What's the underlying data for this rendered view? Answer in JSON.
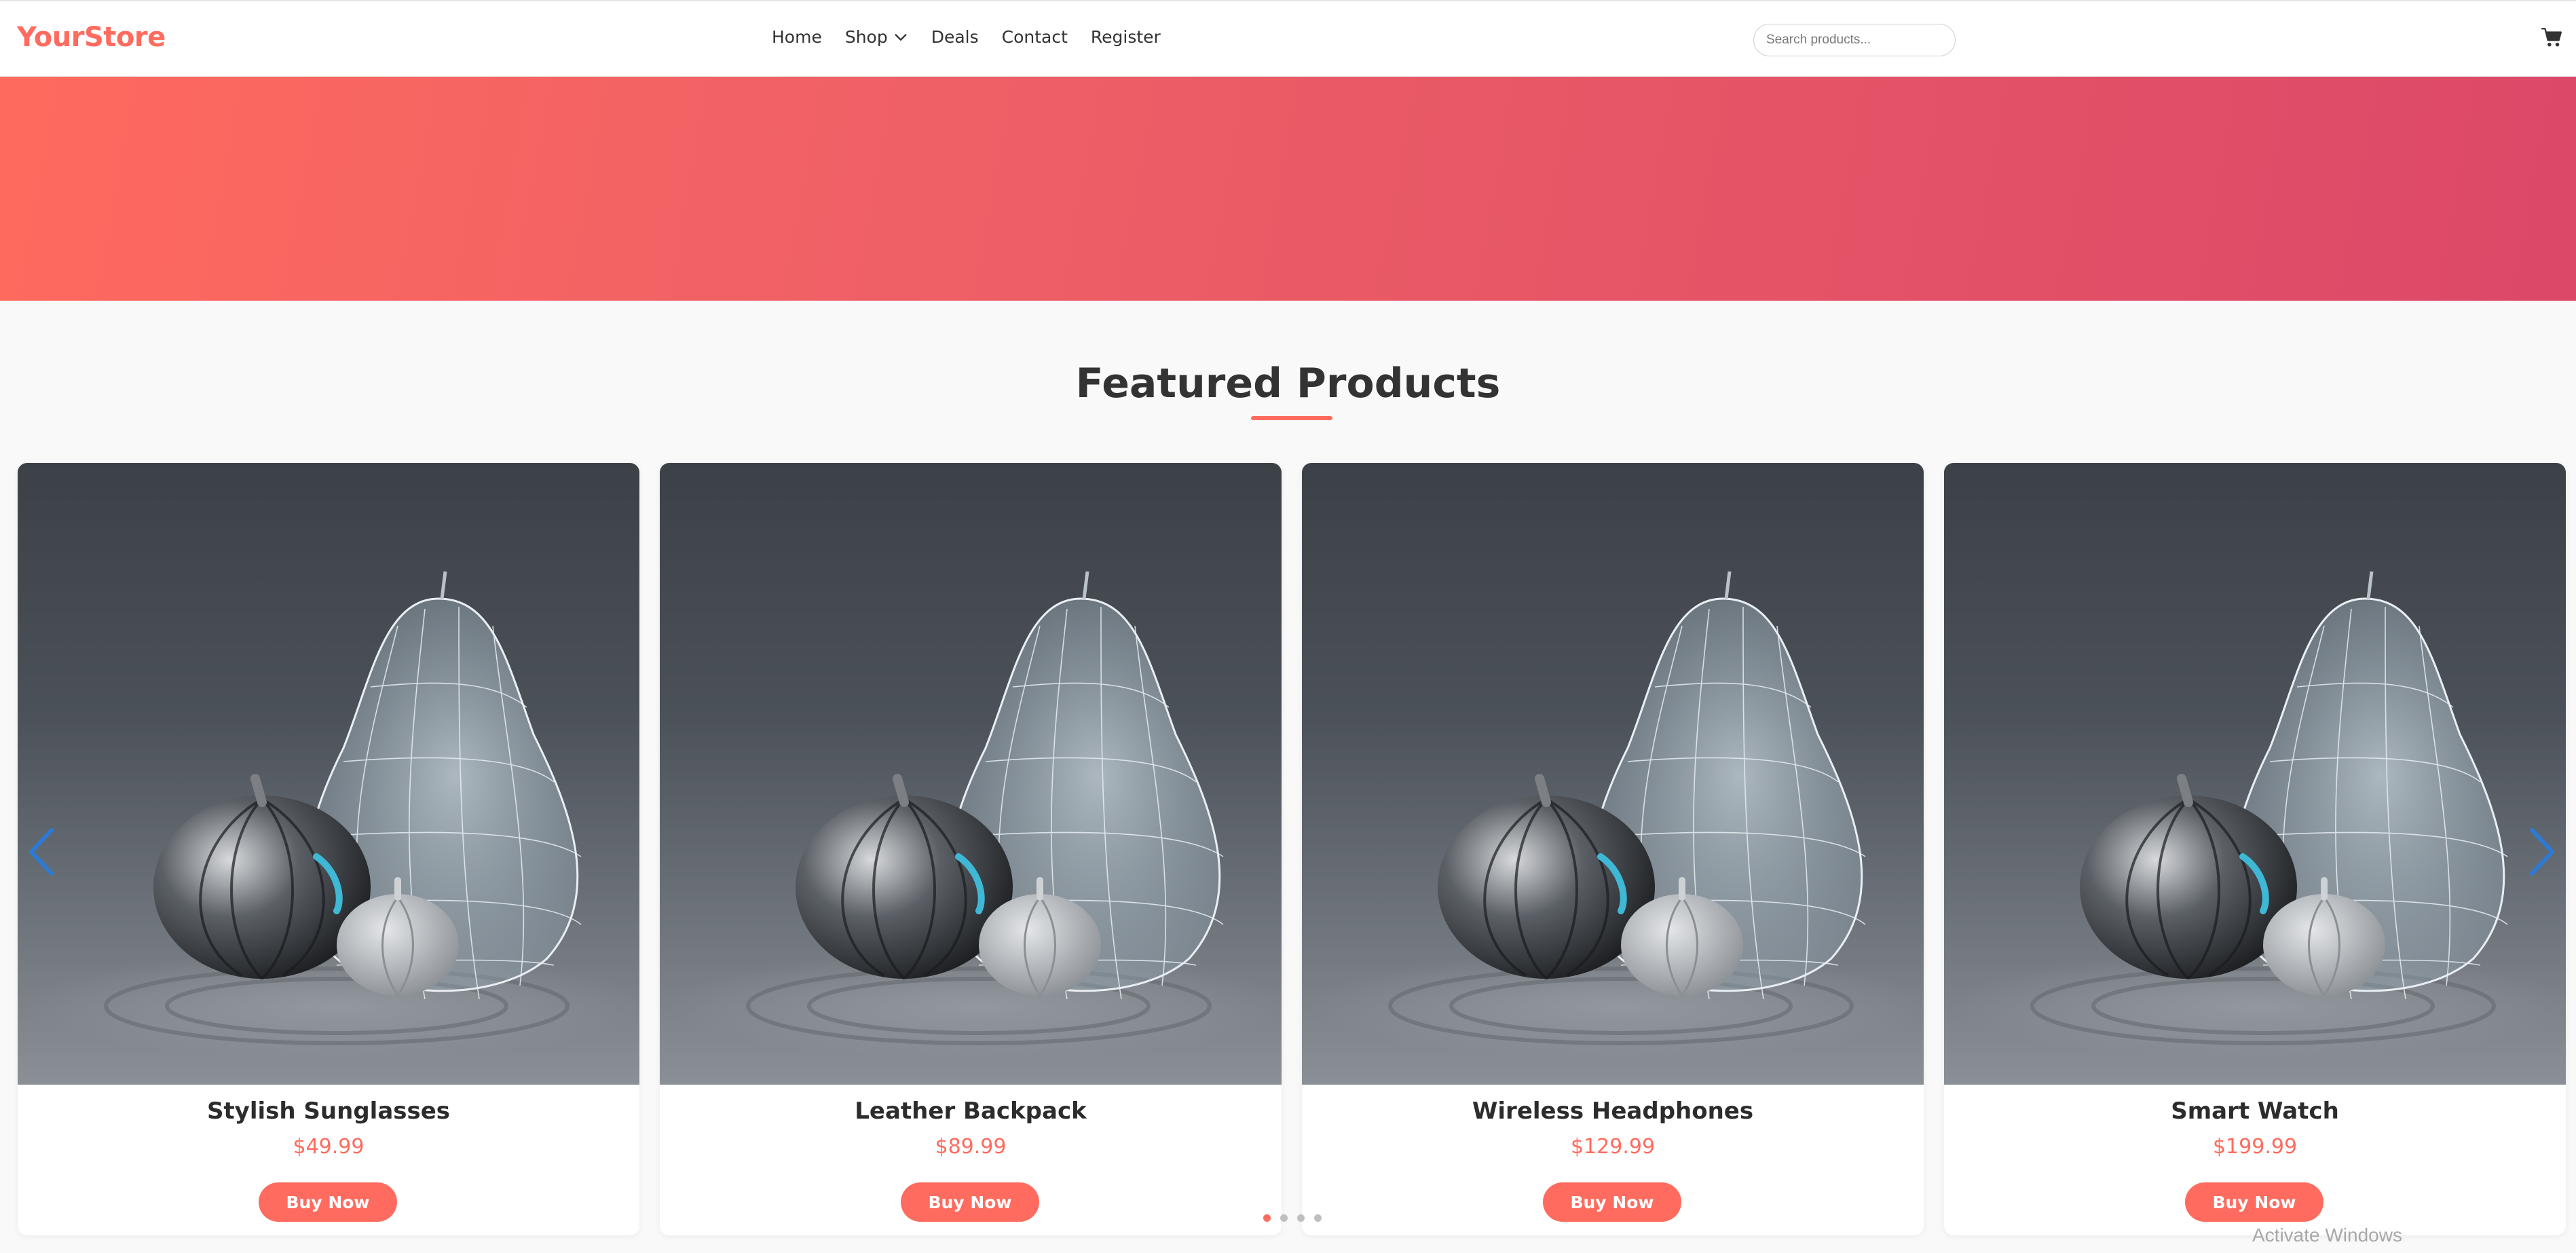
{
  "header": {
    "logo": "YourStore",
    "nav": [
      {
        "label": "Home"
      },
      {
        "label": "Shop"
      },
      {
        "label": "Deals"
      },
      {
        "label": "Contact"
      },
      {
        "label": "Register"
      }
    ],
    "search_placeholder": "Search products...",
    "cart_icon": "shopping-cart-icon"
  },
  "section": {
    "title": "Featured Products"
  },
  "products": [
    {
      "name": "Stylish Sunglasses",
      "price": "$49.99",
      "button": "Buy Now"
    },
    {
      "name": "Leather Backpack",
      "price": "$89.99",
      "button": "Buy Now"
    },
    {
      "name": "Wireless Headphones",
      "price": "$129.99",
      "button": "Buy Now"
    },
    {
      "name": "Smart Watch",
      "price": "$199.99",
      "button": "Buy Now"
    }
  ],
  "carousel": {
    "total_dots": 4,
    "active_dot": 1,
    "prev_icon": "chevron-left-icon",
    "next_icon": "chevron-right-icon"
  },
  "colors": {
    "accent": "#ff6b5e",
    "arrow": "#2b7bd6"
  },
  "watermark": "Activate Windows"
}
